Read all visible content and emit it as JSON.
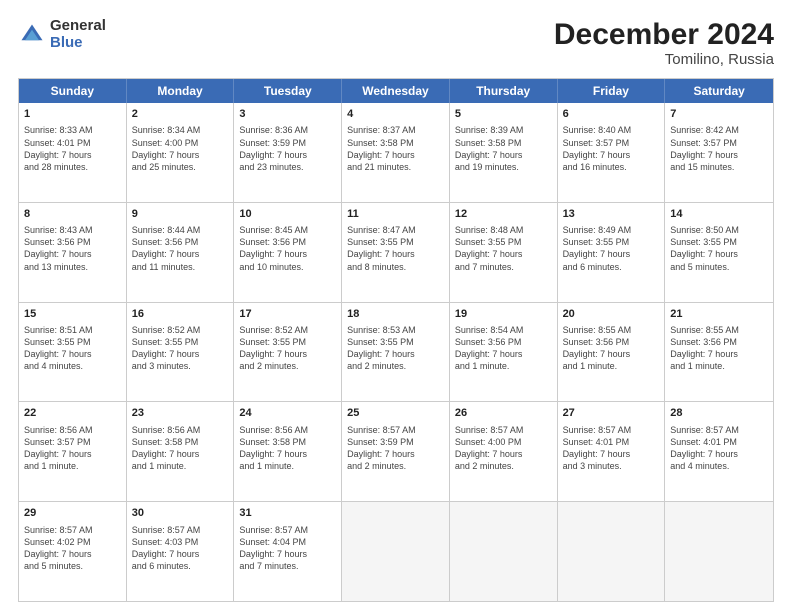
{
  "logo": {
    "general": "General",
    "blue": "Blue"
  },
  "title": "December 2024",
  "subtitle": "Tomilino, Russia",
  "headers": [
    "Sunday",
    "Monday",
    "Tuesday",
    "Wednesday",
    "Thursday",
    "Friday",
    "Saturday"
  ],
  "rows": [
    [
      {
        "day": "1",
        "info": "Sunrise: 8:33 AM\nSunset: 4:01 PM\nDaylight: 7 hours\nand 28 minutes."
      },
      {
        "day": "2",
        "info": "Sunrise: 8:34 AM\nSunset: 4:00 PM\nDaylight: 7 hours\nand 25 minutes."
      },
      {
        "day": "3",
        "info": "Sunrise: 8:36 AM\nSunset: 3:59 PM\nDaylight: 7 hours\nand 23 minutes."
      },
      {
        "day": "4",
        "info": "Sunrise: 8:37 AM\nSunset: 3:58 PM\nDaylight: 7 hours\nand 21 minutes."
      },
      {
        "day": "5",
        "info": "Sunrise: 8:39 AM\nSunset: 3:58 PM\nDaylight: 7 hours\nand 19 minutes."
      },
      {
        "day": "6",
        "info": "Sunrise: 8:40 AM\nSunset: 3:57 PM\nDaylight: 7 hours\nand 16 minutes."
      },
      {
        "day": "7",
        "info": "Sunrise: 8:42 AM\nSunset: 3:57 PM\nDaylight: 7 hours\nand 15 minutes."
      }
    ],
    [
      {
        "day": "8",
        "info": "Sunrise: 8:43 AM\nSunset: 3:56 PM\nDaylight: 7 hours\nand 13 minutes."
      },
      {
        "day": "9",
        "info": "Sunrise: 8:44 AM\nSunset: 3:56 PM\nDaylight: 7 hours\nand 11 minutes."
      },
      {
        "day": "10",
        "info": "Sunrise: 8:45 AM\nSunset: 3:56 PM\nDaylight: 7 hours\nand 10 minutes."
      },
      {
        "day": "11",
        "info": "Sunrise: 8:47 AM\nSunset: 3:55 PM\nDaylight: 7 hours\nand 8 minutes."
      },
      {
        "day": "12",
        "info": "Sunrise: 8:48 AM\nSunset: 3:55 PM\nDaylight: 7 hours\nand 7 minutes."
      },
      {
        "day": "13",
        "info": "Sunrise: 8:49 AM\nSunset: 3:55 PM\nDaylight: 7 hours\nand 6 minutes."
      },
      {
        "day": "14",
        "info": "Sunrise: 8:50 AM\nSunset: 3:55 PM\nDaylight: 7 hours\nand 5 minutes."
      }
    ],
    [
      {
        "day": "15",
        "info": "Sunrise: 8:51 AM\nSunset: 3:55 PM\nDaylight: 7 hours\nand 4 minutes."
      },
      {
        "day": "16",
        "info": "Sunrise: 8:52 AM\nSunset: 3:55 PM\nDaylight: 7 hours\nand 3 minutes."
      },
      {
        "day": "17",
        "info": "Sunrise: 8:52 AM\nSunset: 3:55 PM\nDaylight: 7 hours\nand 2 minutes."
      },
      {
        "day": "18",
        "info": "Sunrise: 8:53 AM\nSunset: 3:55 PM\nDaylight: 7 hours\nand 2 minutes."
      },
      {
        "day": "19",
        "info": "Sunrise: 8:54 AM\nSunset: 3:56 PM\nDaylight: 7 hours\nand 1 minute."
      },
      {
        "day": "20",
        "info": "Sunrise: 8:55 AM\nSunset: 3:56 PM\nDaylight: 7 hours\nand 1 minute."
      },
      {
        "day": "21",
        "info": "Sunrise: 8:55 AM\nSunset: 3:56 PM\nDaylight: 7 hours\nand 1 minute."
      }
    ],
    [
      {
        "day": "22",
        "info": "Sunrise: 8:56 AM\nSunset: 3:57 PM\nDaylight: 7 hours\nand 1 minute."
      },
      {
        "day": "23",
        "info": "Sunrise: 8:56 AM\nSunset: 3:58 PM\nDaylight: 7 hours\nand 1 minute."
      },
      {
        "day": "24",
        "info": "Sunrise: 8:56 AM\nSunset: 3:58 PM\nDaylight: 7 hours\nand 1 minute."
      },
      {
        "day": "25",
        "info": "Sunrise: 8:57 AM\nSunset: 3:59 PM\nDaylight: 7 hours\nand 2 minutes."
      },
      {
        "day": "26",
        "info": "Sunrise: 8:57 AM\nSunset: 4:00 PM\nDaylight: 7 hours\nand 2 minutes."
      },
      {
        "day": "27",
        "info": "Sunrise: 8:57 AM\nSunset: 4:01 PM\nDaylight: 7 hours\nand 3 minutes."
      },
      {
        "day": "28",
        "info": "Sunrise: 8:57 AM\nSunset: 4:01 PM\nDaylight: 7 hours\nand 4 minutes."
      }
    ],
    [
      {
        "day": "29",
        "info": "Sunrise: 8:57 AM\nSunset: 4:02 PM\nDaylight: 7 hours\nand 5 minutes."
      },
      {
        "day": "30",
        "info": "Sunrise: 8:57 AM\nSunset: 4:03 PM\nDaylight: 7 hours\nand 6 minutes."
      },
      {
        "day": "31",
        "info": "Sunrise: 8:57 AM\nSunset: 4:04 PM\nDaylight: 7 hours\nand 7 minutes."
      },
      {
        "day": "",
        "info": ""
      },
      {
        "day": "",
        "info": ""
      },
      {
        "day": "",
        "info": ""
      },
      {
        "day": "",
        "info": ""
      }
    ]
  ]
}
